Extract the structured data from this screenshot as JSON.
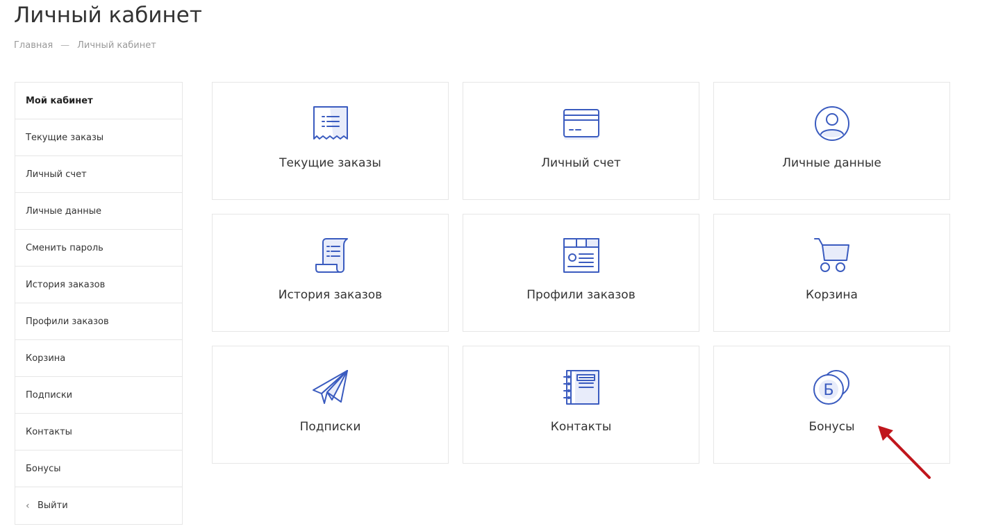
{
  "header": {
    "title": "Личный кабинет"
  },
  "breadcrumb": {
    "home": "Главная",
    "separator": "—",
    "current": "Личный кабинет"
  },
  "sidebar": {
    "items": [
      {
        "label": "Мой кабинет",
        "active": true
      },
      {
        "label": "Текущие заказы"
      },
      {
        "label": "Личный счет"
      },
      {
        "label": "Личные данные"
      },
      {
        "label": "Сменить пароль"
      },
      {
        "label": "История заказов"
      },
      {
        "label": "Профили заказов"
      },
      {
        "label": "Корзина"
      },
      {
        "label": "Подписки"
      },
      {
        "label": "Контакты"
      },
      {
        "label": "Бонусы"
      }
    ],
    "logout": {
      "chevron": "‹",
      "label": "Выйти"
    }
  },
  "tiles": [
    {
      "label": "Текущие заказы",
      "icon": "receipt-icon"
    },
    {
      "label": "Личный счет",
      "icon": "credit-card-icon"
    },
    {
      "label": "Личные данные",
      "icon": "user-icon"
    },
    {
      "label": "История заказов",
      "icon": "scroll-icon"
    },
    {
      "label": "Профили заказов",
      "icon": "profile-card-icon"
    },
    {
      "label": "Корзина",
      "icon": "cart-icon"
    },
    {
      "label": "Подписки",
      "icon": "paper-plane-icon"
    },
    {
      "label": "Контакты",
      "icon": "notebook-icon"
    },
    {
      "label": "Бонусы",
      "icon": "coins-icon",
      "glyph": "Б"
    }
  ],
  "colors": {
    "icon_stroke": "#3a5bbf",
    "icon_fill": "#e8ecfa",
    "annotation_arrow": "#c0161c",
    "border": "#e6e6e6"
  }
}
